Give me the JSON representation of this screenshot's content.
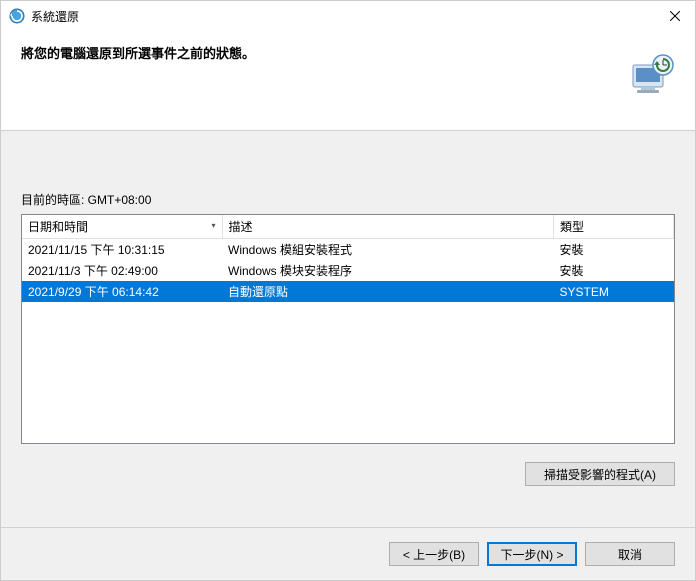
{
  "titlebar": {
    "title": "系統還原"
  },
  "header": {
    "description": "將您的電腦還原到所選事件之前的狀態。"
  },
  "main": {
    "timezone_label": "目前的時區: GMT+08:00",
    "columns": {
      "date": "日期和時間",
      "desc": "描述",
      "type": "類型"
    },
    "rows": [
      {
        "date": "2021/11/15 下午 10:31:15",
        "desc": "Windows 模組安裝程式",
        "type": "安裝",
        "selected": false
      },
      {
        "date": "2021/11/3 下午 02:49:00",
        "desc": "Windows 模块安装程序",
        "type": "安裝",
        "selected": false
      },
      {
        "date": "2021/9/29 下午 06:14:42",
        "desc": "自動還原點",
        "type": "SYSTEM",
        "selected": true
      }
    ],
    "scan_button": "掃描受影響的程式(A)"
  },
  "footer": {
    "back": "< 上一步(B)",
    "next": "下一步(N) >",
    "cancel": "取消"
  }
}
